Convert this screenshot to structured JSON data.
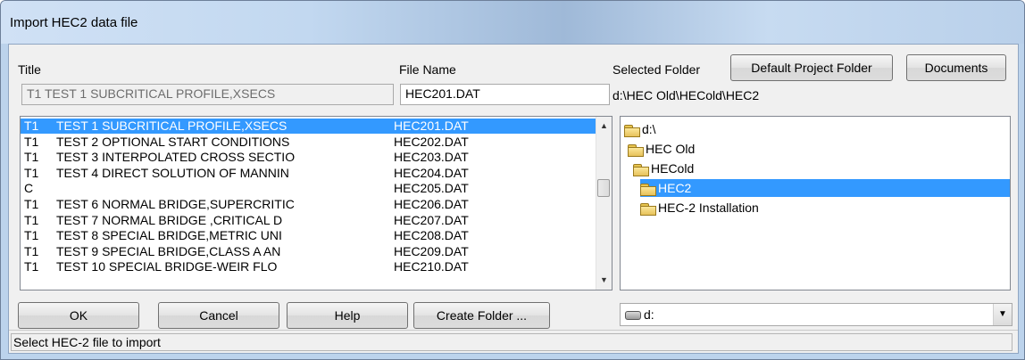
{
  "window": {
    "title": "Import HEC2 data file"
  },
  "labels": {
    "title": "Title",
    "file_name": "File Name",
    "selected_folder": "Selected Folder"
  },
  "fields": {
    "title_value": "T1    TEST 1 SUBCRITICAL PROFILE,XSECS",
    "file_name_value": "HEC201.DAT",
    "folder_path": "d:\\HEC Old\\HECold\\HEC2"
  },
  "buttons": {
    "default_project_folder": "Default Project Folder",
    "documents": "Documents",
    "ok": "OK",
    "cancel": "Cancel",
    "help": "Help",
    "create_folder": "Create Folder ..."
  },
  "file_list": [
    {
      "code": "T1",
      "title": "TEST 1 SUBCRITICAL PROFILE,XSECS",
      "file": "HEC201.DAT",
      "selected": true
    },
    {
      "code": "T1",
      "title": "TEST 2 OPTIONAL START CONDITIONS",
      "file": "HEC202.DAT"
    },
    {
      "code": "T1",
      "title": "TEST 3 INTERPOLATED CROSS SECTIO",
      "file": "HEC203.DAT"
    },
    {
      "code": "T1",
      "title": "TEST 4 DIRECT SOLUTION OF MANNIN",
      "file": "HEC204.DAT"
    },
    {
      "code": "C",
      "title": "",
      "file": "HEC205.DAT"
    },
    {
      "code": "T1",
      "title": "TEST 6 NORMAL BRIDGE,SUPERCRITIC",
      "file": "HEC206.DAT"
    },
    {
      "code": "T1",
      "title": "TEST 7 NORMAL BRIDGE ,CRITICAL D",
      "file": "HEC207.DAT"
    },
    {
      "code": "T1",
      "title": "TEST 8 SPECIAL BRIDGE,METRIC UNI",
      "file": "HEC208.DAT"
    },
    {
      "code": "T1",
      "title": "TEST 9 SPECIAL BRIDGE,CLASS A AN",
      "file": "HEC209.DAT"
    },
    {
      "code": "T1",
      "title": "TEST 10  SPECIAL BRIDGE-WEIR FLO",
      "file": "HEC210.DAT"
    }
  ],
  "folder_tree": [
    {
      "label": "d:\\",
      "icon": "folder-open-icon"
    },
    {
      "label": "HEC Old",
      "icon": "folder-open-icon"
    },
    {
      "label": "HECold",
      "icon": "folder-open-icon"
    },
    {
      "label": "HEC2",
      "icon": "folder-open-icon",
      "selected": true
    },
    {
      "label": "HEC-2 Installation",
      "icon": "folder-closed-icon"
    }
  ],
  "drive_combo": {
    "value": "d:",
    "icon": "drive-icon"
  },
  "status": {
    "text": "Select HEC-2 file to import"
  },
  "colors": {
    "selection": "#3399ff",
    "title_bar": "#bcd3ec"
  }
}
